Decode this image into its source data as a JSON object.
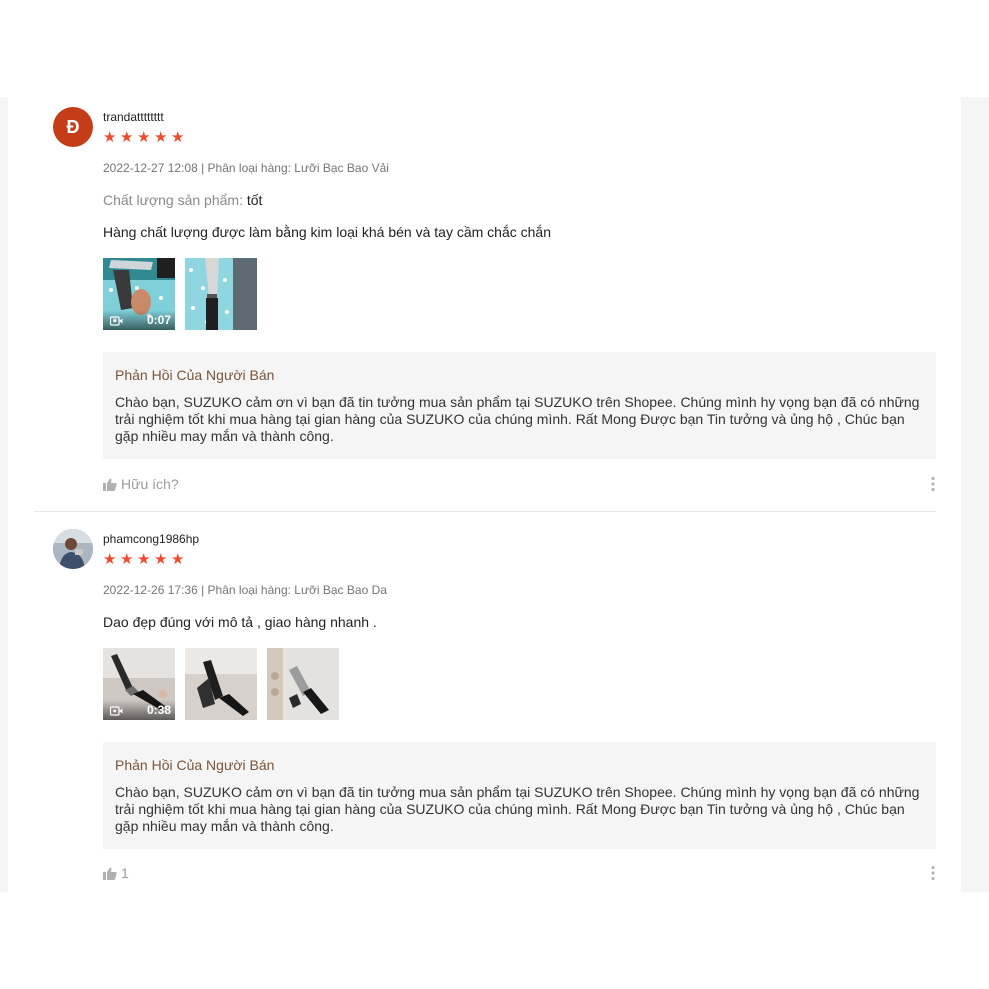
{
  "reviews": [
    {
      "avatar_letter": "Đ",
      "username": "trandatttttttt",
      "rating": 5,
      "date": "2022-12-27 12:08",
      "variation_label": "Phân loại hàng:",
      "variation": "Lưỡi Bạc Bao Vải",
      "attr_label": "Chất lượng sản phẩm:",
      "attr_value": "tốt",
      "comment": "Hàng chất lượng được làm bằng kim loại khá bén và tay cầm chắc chắn",
      "video_duration": "0:07",
      "reply_title": "Phản Hồi Của Người Bán",
      "reply_text": "Chào bạn, SUZUKO cảm ơn vì bạn đã tin tưởng mua sản phẩm tại SUZUKO trên Shopee. Chúng mình hy vọng bạn đã có những trải nghiệm tốt khi mua hàng tại gian hàng của SUZUKO của chúng mình. Rất Mong Được bạn Tin tưởng và ủng hộ , Chúc bạn gặp nhiều may mắn và thành công.",
      "helpful_label": "Hữu ích?"
    },
    {
      "username": "phamcong1986hp",
      "rating": 5,
      "date": "2022-12-26 17:36",
      "variation_label": "Phân loại hàng:",
      "variation": "Lưỡi Bạc Bao Da",
      "comment": "Dao đẹp đúng với mô tả , giao hàng nhanh .",
      "video_duration": "0:38",
      "reply_title": "Phản Hồi Của Người Bán",
      "reply_text": "Chào bạn, SUZUKO cảm ơn vì bạn đã tin tưởng mua sản phẩm tại SUZUKO trên Shopee. Chúng mình hy vọng bạn đã có những trải nghiệm tốt khi mua hàng tại gian hàng của SUZUKO của chúng mình. Rất Mong Được bạn Tin tưởng và ủng hộ , Chúc bạn gặp nhiều may mắn và thành công.",
      "helpful_count": "1"
    }
  ],
  "colors": {
    "star": "#ee4d2d",
    "avatar_bg": "#c43d18",
    "reply_bg": "#f5f5f5",
    "reply_title": "#7a5538"
  },
  "icons": [
    "star-icon",
    "video-camera-icon",
    "thumbs-up-icon",
    "more-vertical-icon"
  ]
}
